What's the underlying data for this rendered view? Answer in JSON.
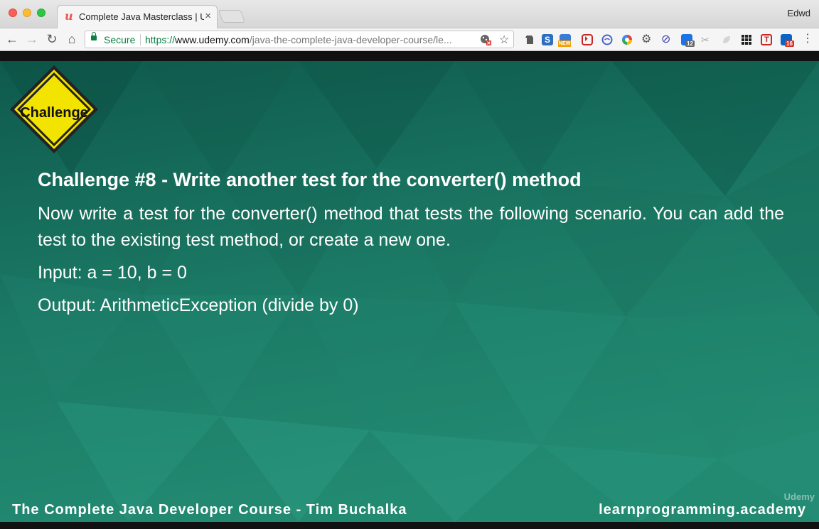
{
  "browser": {
    "tab": {
      "favicon": "u",
      "title": "Complete Java Masterclass | Udemy",
      "close": "×"
    },
    "profile": "Edwd",
    "toolbar": {
      "back": "←",
      "forward": "→",
      "reload": "↻",
      "home": "⌂",
      "secure_label": "Secure",
      "url_scheme": "https://",
      "url_host": "www.udemy.com",
      "url_path": "/java-the-complete-java-developer-course/le...",
      "star": "☆",
      "menu": "⋮"
    },
    "extensions": {
      "evernote": "",
      "s-ext": "S",
      "new-badge": "NEW",
      "lastpass": "⏵",
      "pocket": "",
      "color": "",
      "gear": "⚙",
      "block": "⊘",
      "count12": "12",
      "scissors": "✂",
      "leaf": "",
      "grid": "",
      "t-ext": "T",
      "count16": "16"
    }
  },
  "slide": {
    "sign_label": "Challenge",
    "heading": "Challenge #8 - Write another test for the converter() method",
    "paragraph": "Now write a test for the converter() method that tests the following scenario. You can add the test to the existing test method, or create a new one.",
    "input_line": "Input: a = 10, b = 0",
    "output_line": "Output: ArithmeticException (divide by 0)",
    "footer_left": "The Complete Java Developer Course - Tim Buchalka",
    "footer_right": "learnprogramming.academy",
    "watermark": "Udemy",
    "colors": {
      "background": "#1d7a63",
      "sign_fill": "#f3e400",
      "text": "#ffffff"
    }
  }
}
